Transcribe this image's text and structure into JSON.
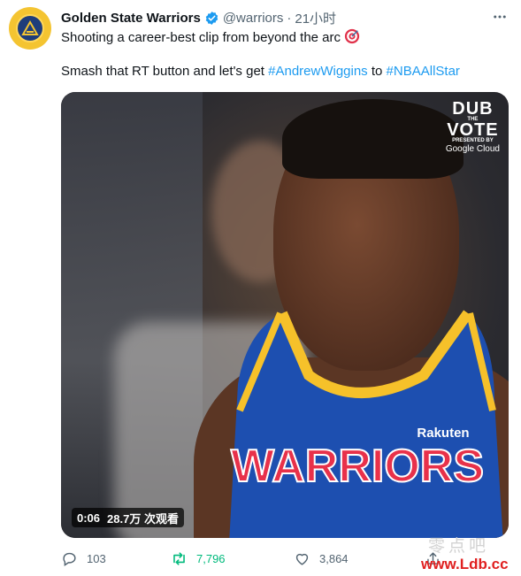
{
  "tweet": {
    "display_name": "Golden State Warriors",
    "handle": "@warriors",
    "separator": "·",
    "time": "21小时",
    "line1": "Shooting a career-best clip from beyond the arc",
    "line2_prefix": "Smash that RT button and let's get ",
    "hashtag1": "#AndrewWiggins",
    "line2_middle": " to ",
    "hashtag2": "#NBAAllStar"
  },
  "media": {
    "overlay": {
      "line1": "DUB",
      "line2": "THE",
      "line3": "VOTE",
      "presented": "PRESENTED BY",
      "sponsor": "Google Cloud"
    },
    "jersey_text": "WARRIORS",
    "jersey_sponsor": "Rakuten",
    "video_time": "0:06",
    "video_views": "28.7万 次观看"
  },
  "actions": {
    "reply_count": "103",
    "retweet_count": "7,796",
    "like_count": "3,864"
  },
  "watermark": {
    "chinese": "零点吧",
    "url": "www.Ldb.cc"
  },
  "icons": {
    "avatar": "warriors-logo-icon",
    "verified": "verified-badge-icon",
    "more": "more-icon",
    "target": "direct-hit-emoji-icon",
    "reply": "reply-icon",
    "retweet": "retweet-icon",
    "like": "heart-icon",
    "share": "share-icon"
  },
  "colors": {
    "link": "#1d9bf0",
    "verified": "#1d9bf0",
    "retweet_active": "#00ba7c",
    "muted_text": "#536471"
  }
}
